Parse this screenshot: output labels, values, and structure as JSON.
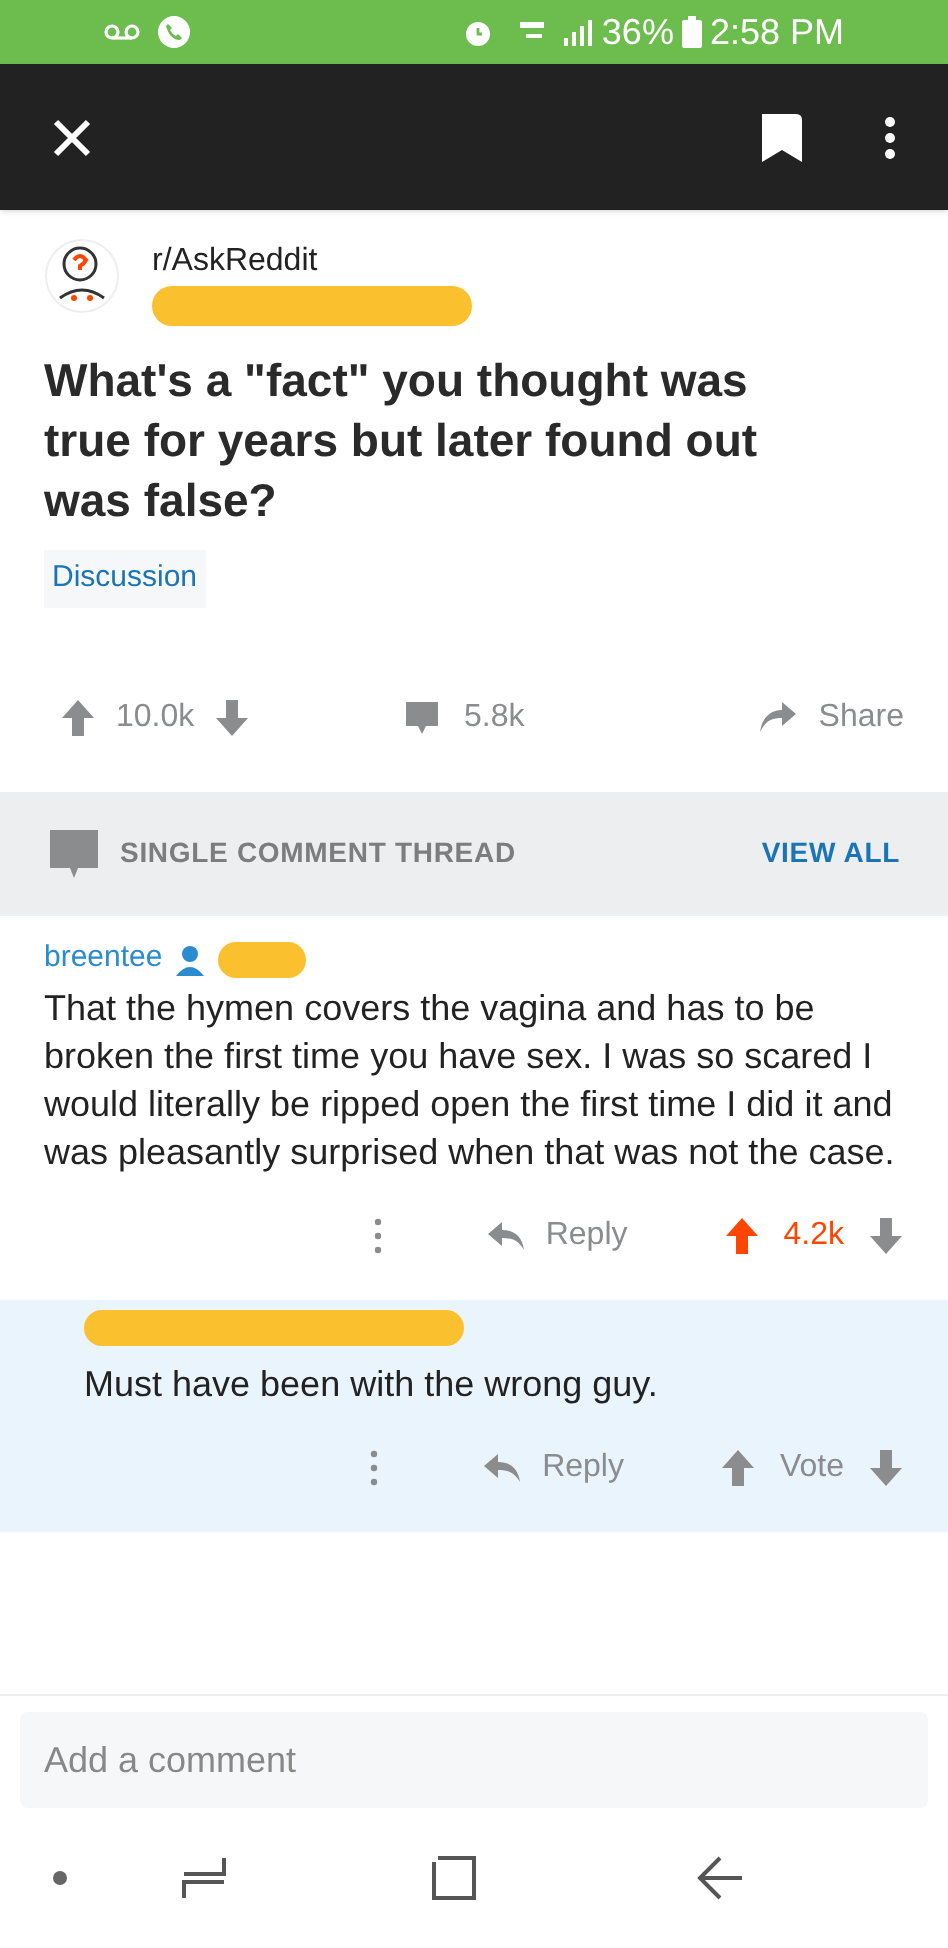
{
  "status_bar": {
    "battery": "36%",
    "time": "2:58 PM"
  },
  "post": {
    "subreddit": "r/AskReddit",
    "title": "What's a \"fact\" you thought was true for years but later found out was false?",
    "flair": "Discussion",
    "votes": "10.0k",
    "comments": "5.8k",
    "share": "Share"
  },
  "thread_bar": {
    "label": "SINGLE COMMENT THREAD",
    "action": "VIEW ALL"
  },
  "comments": [
    {
      "author": "breentee",
      "highlighted": false,
      "upvoted": true,
      "text": "That the hymen covers the vagina and has to be broken the first time you have sex. I was so scared I would literally be ripped open the first time I did it and was pleasantly surprised when that was not the case.",
      "reply": "Reply",
      "score": "4.2k"
    },
    {
      "highlighted": true,
      "upvoted": false,
      "text": "Must have been with the wrong guy.",
      "reply": "Reply",
      "score": "Vote"
    }
  ],
  "comment_field": {
    "placeholder": "Add a comment"
  }
}
